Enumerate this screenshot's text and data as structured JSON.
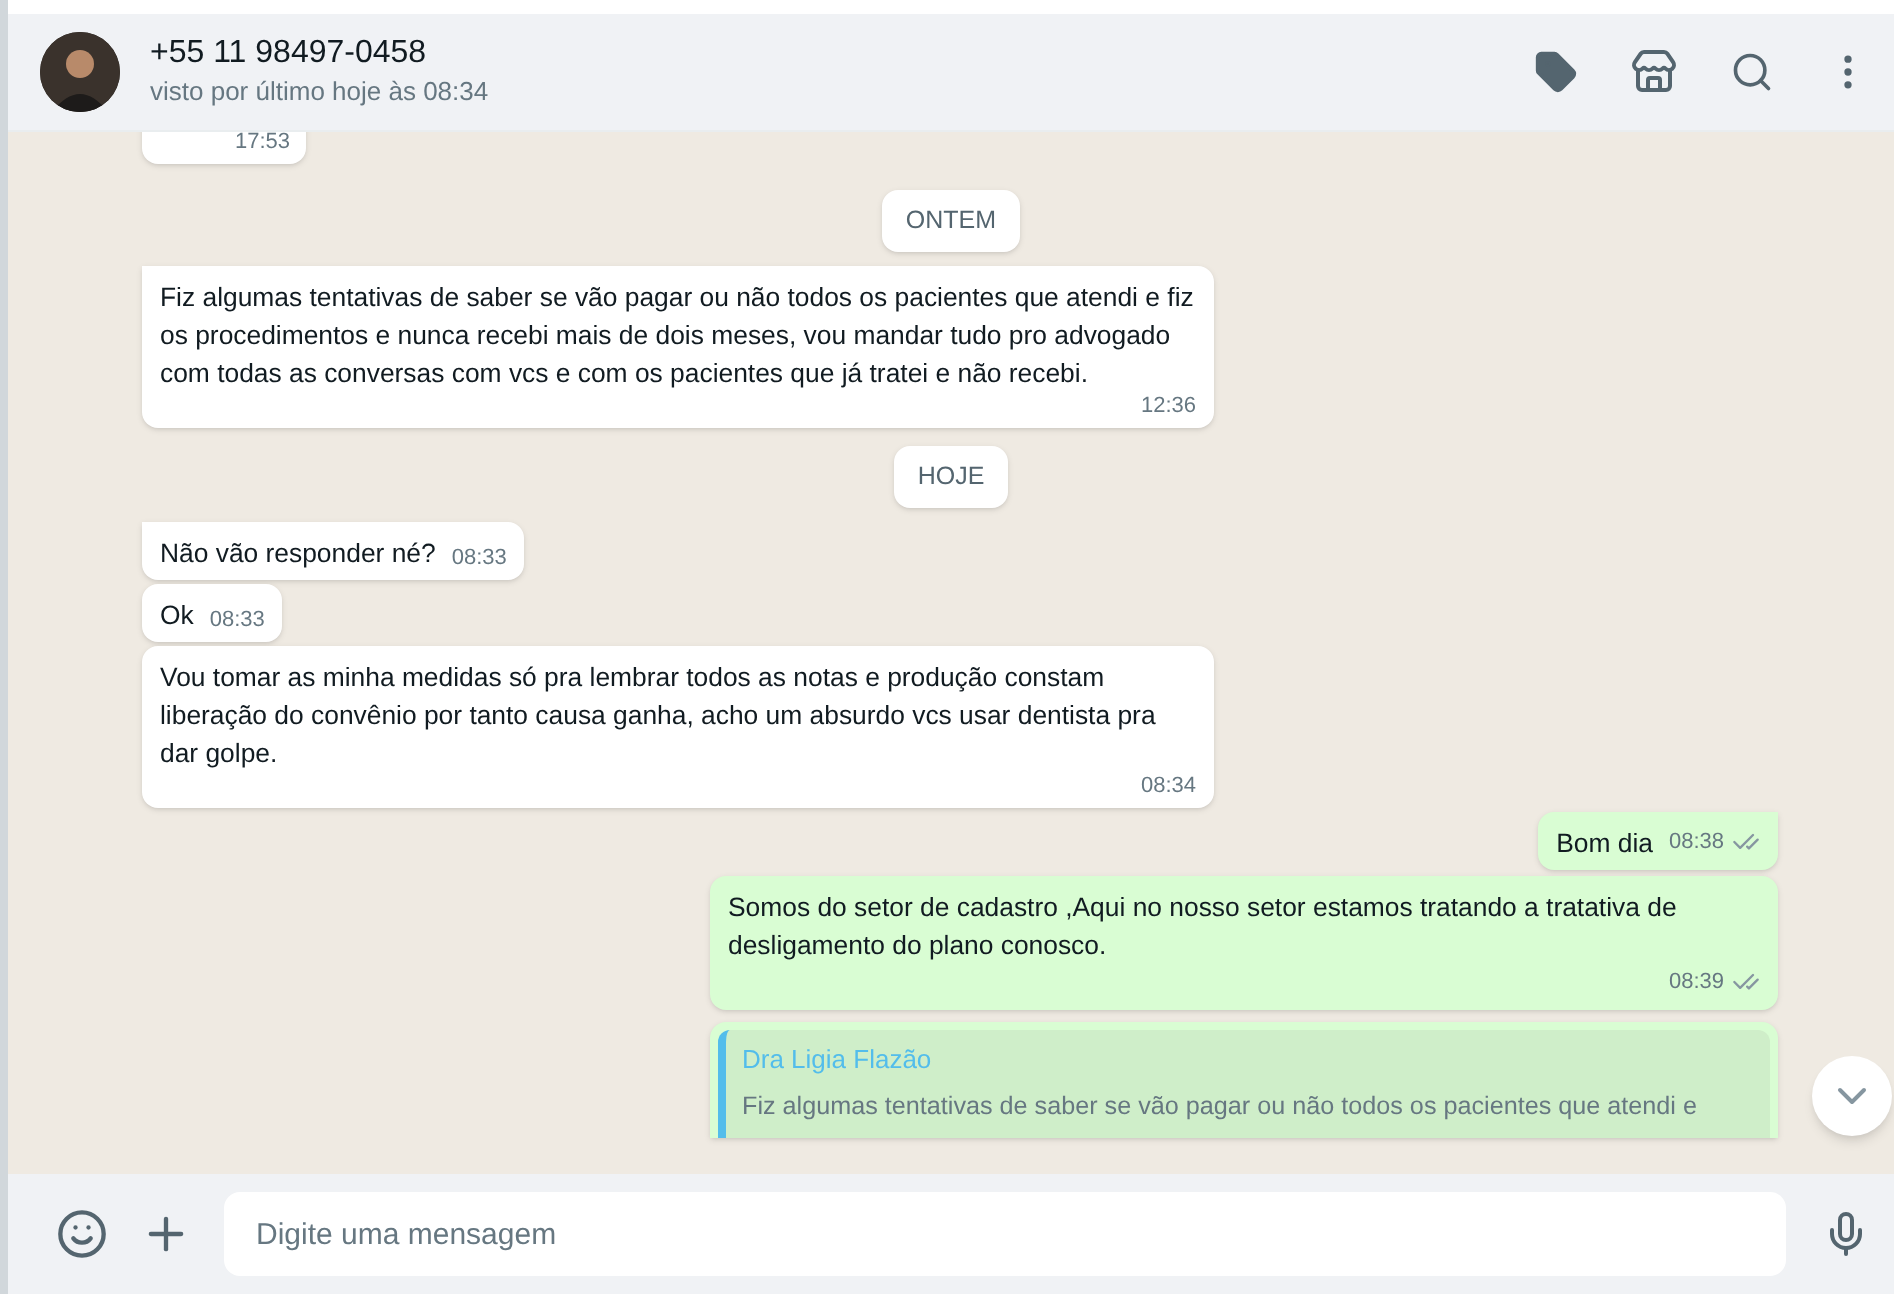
{
  "header": {
    "title": "+55 11 98497-0458",
    "subtitle": "visto por último hoje às 08:34"
  },
  "messages": [
    {
      "kind": "stub",
      "time": "17:53"
    },
    {
      "kind": "date",
      "text": "ONTEM"
    },
    {
      "kind": "in",
      "text": "Fiz algumas tentativas de saber se vão pagar ou não todos os pacientes que atendi e fiz os procedimentos e nunca recebi mais de dois meses, vou mandar tudo pro advogado com todas as conversas com vcs e com os pacientes que já tratei e não recebi.",
      "time": "12:36",
      "tail": true
    },
    {
      "kind": "date",
      "text": "HOJE"
    },
    {
      "kind": "in",
      "text": "Não vão responder né?",
      "time": "08:33",
      "tail": true
    },
    {
      "kind": "in",
      "text": "Ok",
      "time": "08:33",
      "tail": false
    },
    {
      "kind": "in",
      "text": "Vou tomar as minha medidas só pra lembrar todos as notas e produção constam liberação do convênio por tanto causa ganha, acho um absurdo vcs usar dentista pra dar golpe.",
      "time": "08:34",
      "tail": false
    },
    {
      "kind": "out",
      "text": "Bom dia",
      "time": "08:38",
      "tail": true,
      "read": false
    },
    {
      "kind": "out",
      "text": "Somos do setor de cadastro ,Aqui no nosso setor estamos tratando a tratativa de desligamento do plano conosco.",
      "time": "08:39",
      "tail": false,
      "read": false
    },
    {
      "kind": "quote",
      "author": "Dra Ligia Flazão",
      "text": "Fiz algumas tentativas de saber se vão pagar ou não todos os pacientes que atendi e"
    }
  ],
  "composer": {
    "placeholder": "Digite uma mensagem"
  }
}
